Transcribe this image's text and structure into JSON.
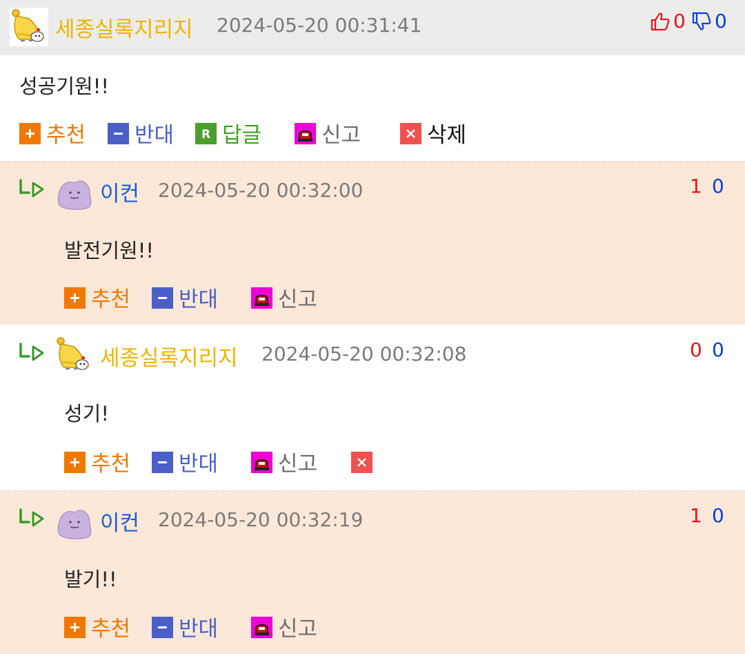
{
  "comments": [
    {
      "author": "세종실록지리지",
      "time": "2024-05-20 00:31:41",
      "text": "성공기원!!",
      "up": "0",
      "down": "0",
      "actions": {
        "recommend": "추천",
        "oppose": "반대",
        "reply": "답글",
        "report": "신고",
        "delete": "삭제"
      }
    },
    {
      "author": "이컨",
      "time": "2024-05-20 00:32:00",
      "text": "발전기원!!",
      "up": "1",
      "down": "0",
      "actions": {
        "recommend": "추천",
        "oppose": "반대",
        "report": "신고"
      }
    },
    {
      "author": "세종실록지리지",
      "time": "2024-05-20 00:32:08",
      "text": "성기!",
      "up": "0",
      "down": "0",
      "actions": {
        "recommend": "추천",
        "oppose": "반대",
        "report": "신고"
      }
    },
    {
      "author": "이컨",
      "time": "2024-05-20 00:32:19",
      "text": "발기!!",
      "up": "1",
      "down": "0",
      "actions": {
        "recommend": "추천",
        "oppose": "반대",
        "report": "신고"
      }
    }
  ],
  "colors": {
    "author_gold": "#f0b400",
    "author_blue": "#1a5fd4",
    "up": "#e8131b",
    "down": "#0b3fd8",
    "recommend": "#f07800",
    "oppose": "#4a5fc8",
    "reply": "#3ea020",
    "report": "#e000c8",
    "delete": "#f05050",
    "reply_row_bg": "#fce8d8"
  },
  "icons": {
    "bell_avatar": "bell-bird-avatar",
    "ditto_avatar": "purple-blob-avatar",
    "thumb_up": "thumbs-up-icon",
    "thumb_down": "thumbs-down-icon",
    "reply_arrow": "reply-arrow-icon",
    "plus": "plus-icon",
    "minus": "minus-icon",
    "reply": "r-icon",
    "report": "siren-icon",
    "delete": "x-icon"
  }
}
